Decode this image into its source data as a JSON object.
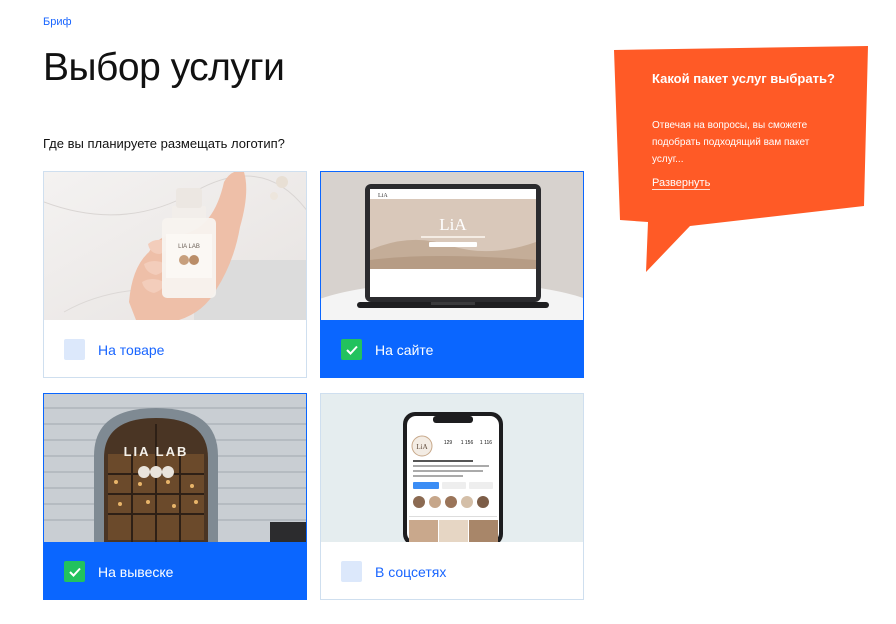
{
  "breadcrumb": "Бриф",
  "title": "Выбор услуги",
  "question": "Где вы планируете размещать логотип?",
  "options": [
    {
      "label": "На товаре",
      "selected": false
    },
    {
      "label": "На сайте",
      "selected": true
    },
    {
      "label": "На вывеске",
      "selected": true
    },
    {
      "label": "В соцсетях",
      "selected": false
    }
  ],
  "photos": {
    "product_bottle": "LIA LAB",
    "website_logo": "LiA",
    "sign_text": "LIA LAB",
    "phone_logo": "LiA",
    "phone_stats": [
      "129",
      "1 156",
      "1 116"
    ]
  },
  "promo": {
    "title": "Какой пакет услуг выбрать?",
    "text": "Отвечая на вопросы, вы сможете подобрать подходящий вам пакет услуг...",
    "link": "Развернуть",
    "color": "#ff5a26"
  },
  "colors": {
    "accent": "#0a66ff",
    "check": "#22c25e",
    "border": "#cfdfef"
  }
}
